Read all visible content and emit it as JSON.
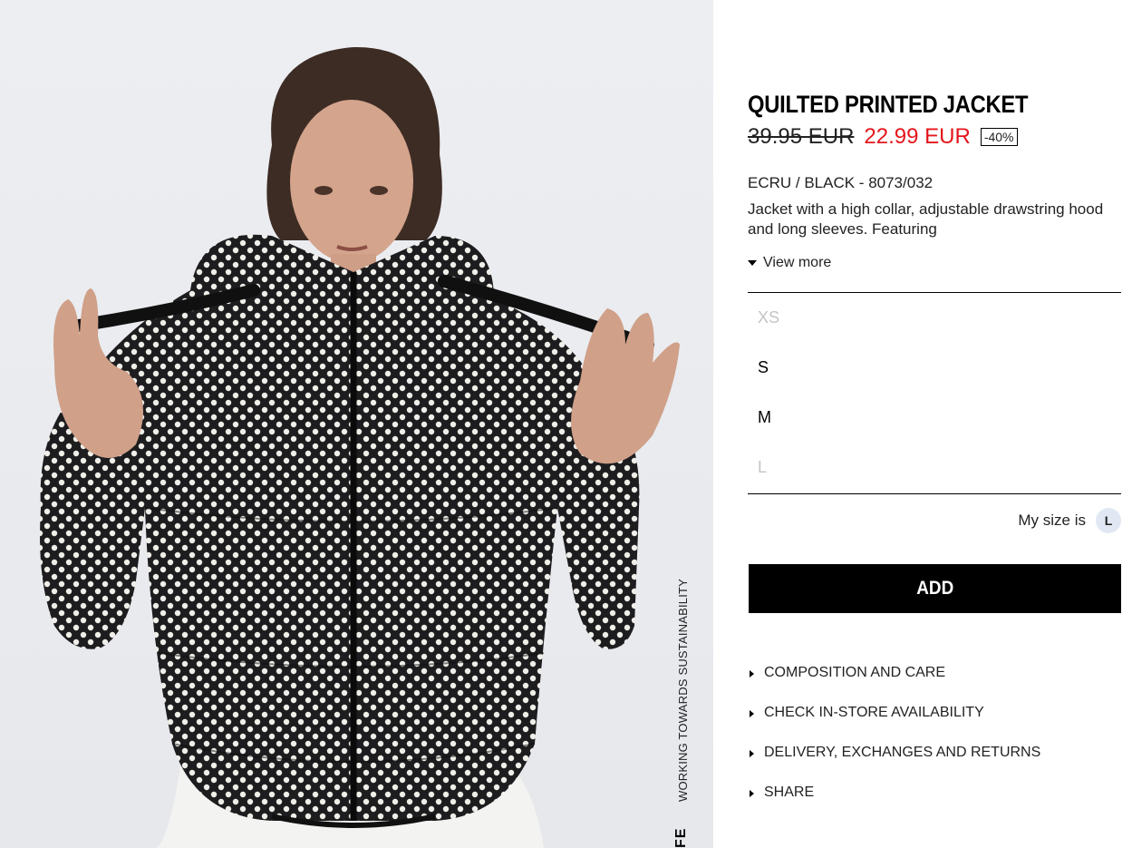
{
  "product": {
    "title": "QUILTED PRINTED JACKET",
    "old_price": "39.95 EUR",
    "new_price": "22.99 EUR",
    "discount": "-40%",
    "color_ref": "ECRU / BLACK - 8073/032",
    "description": "Jacket with a high collar, adjustable drawstring hood and long sleeves. Featuring",
    "view_more": "View more"
  },
  "sizes": [
    {
      "label": "XS",
      "available": false
    },
    {
      "label": "S",
      "available": true
    },
    {
      "label": "M",
      "available": true
    },
    {
      "label": "L",
      "available": false
    }
  ],
  "my_size": {
    "label": "My size is",
    "value": "L"
  },
  "add_button": "ADD",
  "info_links": [
    "COMPOSITION AND CARE",
    "CHECK IN-STORE AVAILABILITY",
    "DELIVERY, EXCHANGES AND RETURNS",
    "SHARE"
  ],
  "photo": {
    "vertical_text": "WORKING TOWARDS SUSTAINABILITY",
    "vertical_brand": "FE"
  },
  "colors": {
    "sale": "#e4161c",
    "button": "#000000",
    "badge_bg": "#e1e8f4",
    "unavailable": "#c4c4c4"
  }
}
